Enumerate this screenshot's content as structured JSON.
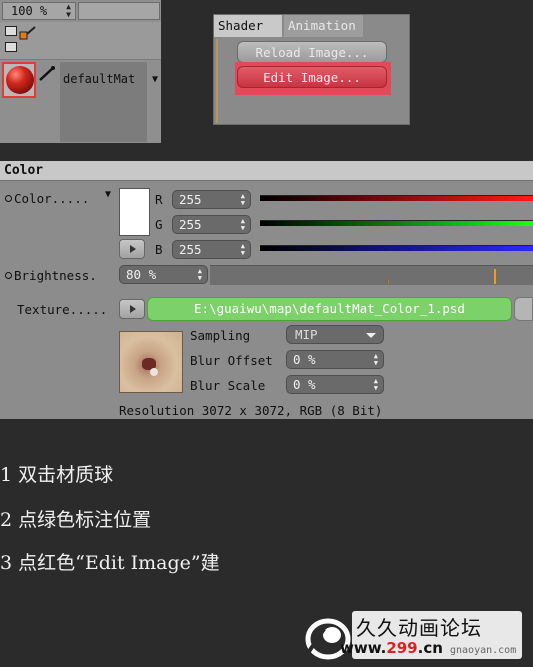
{
  "material_manager": {
    "zoom_value": "100 %",
    "material_name": "defaultMat"
  },
  "shader_panel": {
    "tabs": [
      "Shader",
      "Animation"
    ],
    "reload_button": "Reload Image...",
    "edit_button": "Edit Image..."
  },
  "color_panel": {
    "header": "Color",
    "color_label": "Color.....",
    "r_label": "R",
    "g_label": "G",
    "b_label": "B",
    "r_value": "255",
    "g_value": "255",
    "b_value": "255",
    "brightness_label": "Brightness.",
    "brightness_value": "80 %",
    "texture_label": "Texture.....",
    "texture_path": "E:\\guaiwu\\map\\defaultMat_Color_1.psd",
    "sampling_label": "Sampling",
    "sampling_value": "MIP",
    "blur_offset_label": "Blur Offset",
    "blur_offset_value": "0 %",
    "blur_scale_label": "Blur Scale",
    "blur_scale_value": "0 %",
    "resolution_text": "Resolution 3072 x 3072, RGB (8 Bit)",
    "swatch_color": "#ffffff",
    "highlight_green": "#7dd16a",
    "highlight_red": "#e14a58"
  },
  "instructions": [
    "1  双击材质球",
    "2  点绿色标注位置",
    "3  点红色“Edit Image”建"
  ],
  "watermark": {
    "title": "久久动画论坛",
    "url_prefix": "www.",
    "url_number": "299",
    "url_suffix": ".cn",
    "subtext": "gnaoyan.com"
  }
}
